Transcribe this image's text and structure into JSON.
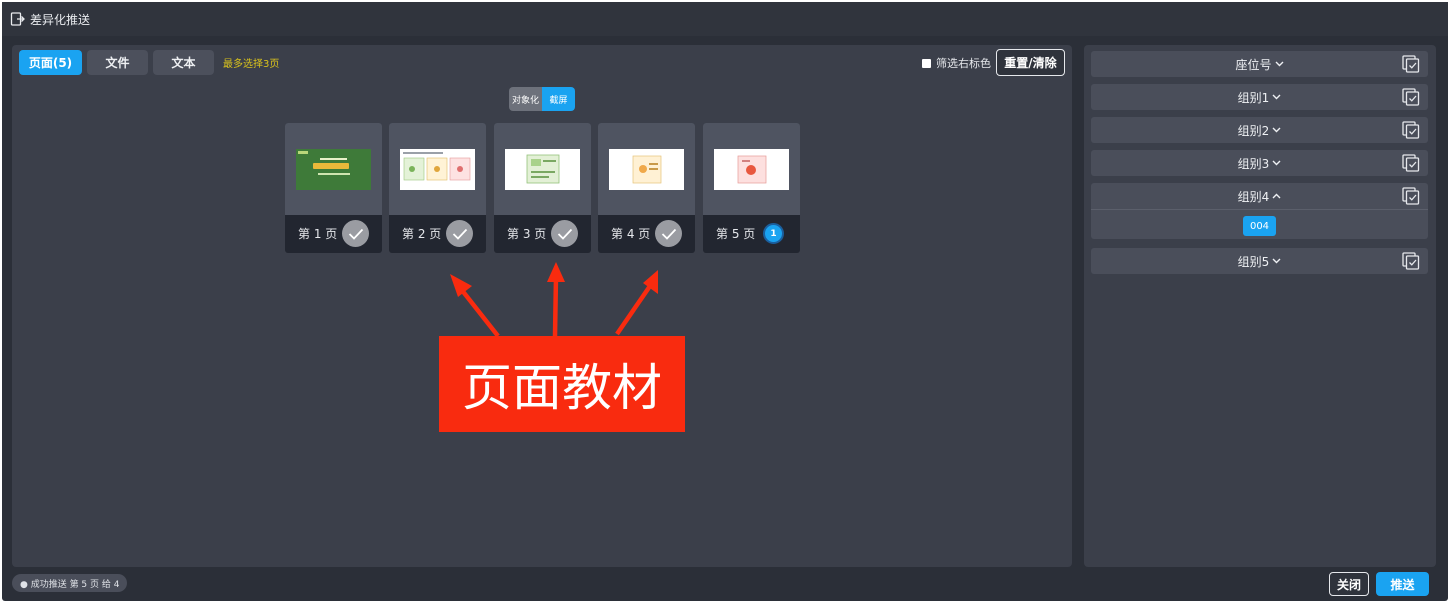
{
  "window": {
    "title": "差异化推送"
  },
  "tabs": [
    {
      "label": "页面(5)",
      "active": true
    },
    {
      "label": "文件",
      "active": false
    },
    {
      "label": "文本",
      "active": false
    }
  ],
  "tab_hint": "最多选择3页",
  "filter": {
    "label": "筛选右标色",
    "checked": false
  },
  "reset_label": "重置/清除",
  "mode_toggle": {
    "object": "对象化",
    "screenshot": "截屏",
    "selected": "截屏"
  },
  "pages": [
    {
      "label": "第 1 页",
      "state": "check"
    },
    {
      "label": "第 2 页",
      "state": "check"
    },
    {
      "label": "第 3 页",
      "state": "check"
    },
    {
      "label": "第 4 页",
      "state": "check"
    },
    {
      "label": "第 5 页",
      "state": "selected",
      "badge": "1"
    }
  ],
  "annotation": {
    "text": "页面教材",
    "color": "#f92b0f"
  },
  "groups": [
    {
      "label": "座位号",
      "expanded": false
    },
    {
      "label": "组别1",
      "expanded": false
    },
    {
      "label": "组别2",
      "expanded": false
    },
    {
      "label": "组别3",
      "expanded": false
    },
    {
      "label": "组别4",
      "expanded": true,
      "members": [
        "004"
      ]
    },
    {
      "label": "组别5",
      "expanded": false
    }
  ],
  "status": "● 成功推送 第 5 页 给 4",
  "buttons": {
    "close": "关闭",
    "push": "推送"
  },
  "colors": {
    "accent": "#1aa3f1",
    "background": "#2b2f38",
    "panel": "#3b3f4a",
    "hint": "#d9c21c"
  }
}
